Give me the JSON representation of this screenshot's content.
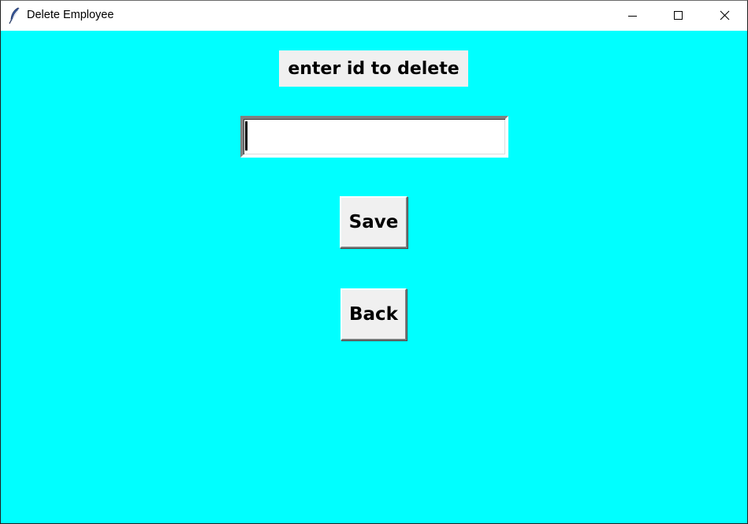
{
  "window": {
    "title": "Delete Employee",
    "app_icon": "feather-icon",
    "controls": [
      "minimize-icon",
      "maximize-icon",
      "close-icon"
    ]
  },
  "form": {
    "prompt_label": "enter id to delete",
    "id_input_value": "",
    "save_label": "Save",
    "back_label": "Back"
  },
  "colors": {
    "background": "#00ffff",
    "widget_face": "#f0f0f0"
  }
}
